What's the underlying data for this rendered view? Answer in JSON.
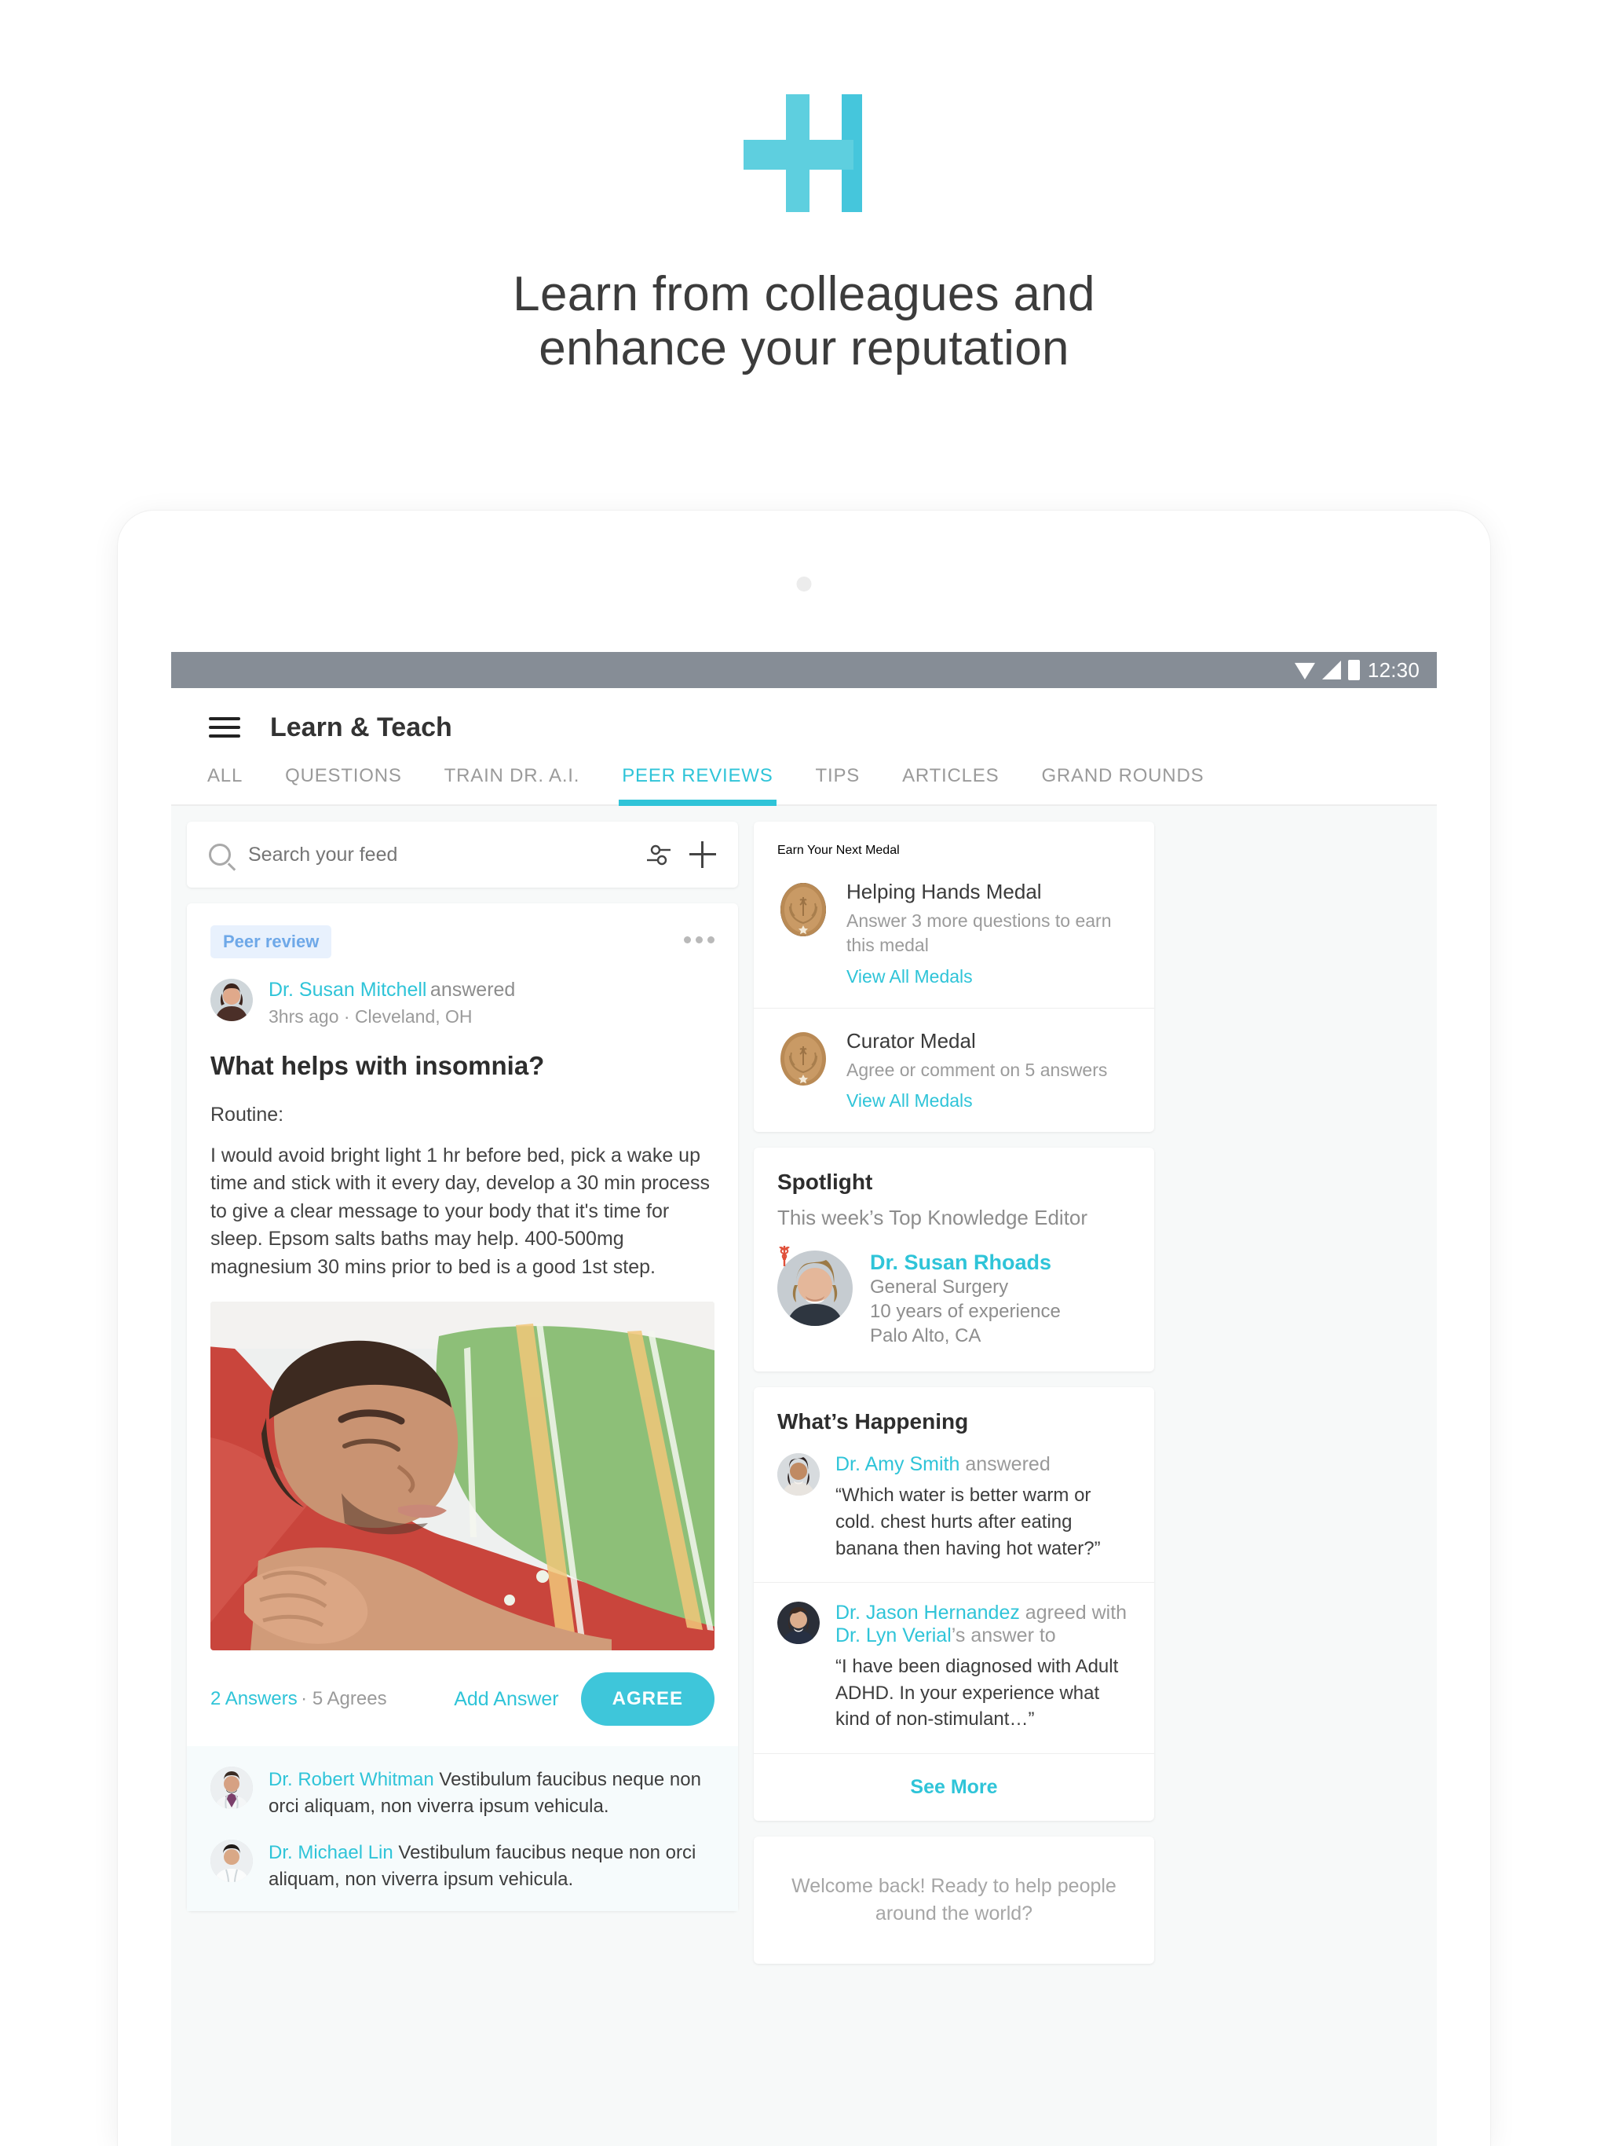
{
  "promo": {
    "logo_icon": "healthtap-h-logo",
    "headline_line1": "Learn from colleagues and",
    "headline_line2": "enhance your reputation"
  },
  "statusbar": {
    "wifi_icon": "wifi-icon",
    "signal_icon": "signal-icon",
    "battery_icon": "battery-icon",
    "time": "12:30"
  },
  "appbar": {
    "menu_icon": "hamburger-menu-icon",
    "title": "Learn & Teach"
  },
  "tabs": [
    {
      "label": "ALL",
      "active": false
    },
    {
      "label": "QUESTIONS",
      "active": false
    },
    {
      "label": "TRAIN DR. A.I.",
      "active": false
    },
    {
      "label": "PEER REVIEWS",
      "active": true
    },
    {
      "label": "TIPS",
      "active": false
    },
    {
      "label": "ARTICLES",
      "active": false
    },
    {
      "label": "GRAND ROUNDS",
      "active": false
    }
  ],
  "search": {
    "placeholder": "Search your feed",
    "search_icon": "search-icon",
    "filter_icon": "tune-filter-icon",
    "add_icon": "plus-icon"
  },
  "post": {
    "badge": "Peer review",
    "more_icon": "more-options-icon",
    "author": "Dr. Susan Mitchell",
    "verb": "answered",
    "meta": "3hrs ago · Cleveland, OH",
    "title": "What helps with insomnia?",
    "body_1": "Routine:",
    "body_2": "I would avoid bright light 1 hr before bed, pick a wake up time and stick with it every day, develop a 30 min process to give a clear message to your body that it's time for sleep. Epsom salts baths may help. 400-500mg magnesium 30 mins prior to bed is a good 1st step.",
    "image_alt": "sleeping-man-photo",
    "answers": "2 Answers",
    "agrees": "· 5 Agrees",
    "add_answer": "Add Answer",
    "agree_button": "AGREE"
  },
  "comments": [
    {
      "name": "Dr. Robert Whitman",
      "text": " Vestibulum faucibus neque non orci aliquam, non viverra ipsum vehicula."
    },
    {
      "name": "Dr. Michael Lin",
      "text": " Vestibulum faucibus neque non orci aliquam, non viverra ipsum vehicula."
    }
  ],
  "medals": {
    "title": "Earn Your Next Medal",
    "items": [
      {
        "icon": "bronze-medal-icon",
        "name": "Helping Hands Medal",
        "desc": "Answer 3 more questions to earn this medal",
        "link": "View All Medals"
      },
      {
        "icon": "bronze-medal-icon",
        "name": "Curator Medal",
        "desc": "Agree or comment on 5 answers",
        "link": "View All Medals"
      }
    ]
  },
  "spotlight": {
    "title": "Spotlight",
    "subtitle": "This week’s Top Knowledge Editor",
    "badge_icon": "caduceus-icon",
    "name": "Dr. Susan Rhoads",
    "specialty": "General Surgery",
    "experience": "10 years of experience",
    "location": "Palo Alto, CA"
  },
  "whats_happening": {
    "title": "What’s Happening",
    "items": [
      {
        "name": "Dr. Amy Smith",
        "verb": " answered",
        "name2": "",
        "verb2": "",
        "quote": "“Which water is better warm or cold. chest hurts after eating banana then having hot water?”"
      },
      {
        "name": "Dr. Jason Hernandez",
        "verb": " agreed with",
        "name2": "Dr. Lyn Verial",
        "verb2": "’s answer to",
        "quote": "“I have been diagnosed with Adult ADHD. In your experience what kind of non-stimulant…”"
      }
    ],
    "see_more": "See More"
  },
  "welcome": {
    "text": "Welcome back! Ready to help people around the world?"
  },
  "colors": {
    "accent": "#2fc4d8",
    "accent_button": "#3ec6da",
    "badge_bg": "#e8f1fd",
    "badge_text": "#6ea8e8",
    "statusbar": "#868d96",
    "page_bg": "#f7f9f9"
  }
}
